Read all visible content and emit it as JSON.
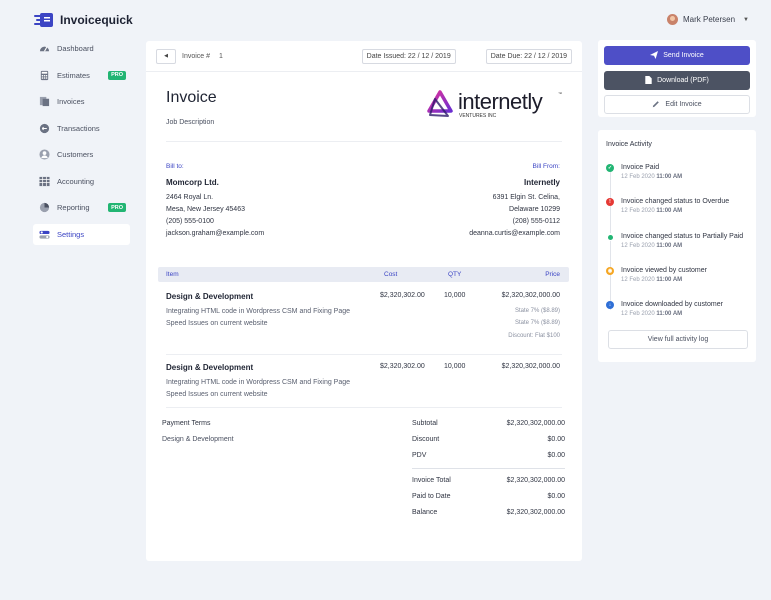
{
  "app": {
    "name": "Invoicequick"
  },
  "user": {
    "name": "Mark Petersen"
  },
  "sidebar": {
    "items": [
      {
        "label": "Dashboard",
        "icon": "dashboard-icon",
        "pro": ""
      },
      {
        "label": "Estimates",
        "icon": "calculator-icon",
        "pro": "PRO"
      },
      {
        "label": "Invoices",
        "icon": "invoice-icon",
        "pro": ""
      },
      {
        "label": "Transactions",
        "icon": "transactions-icon",
        "pro": ""
      },
      {
        "label": "Customers",
        "icon": "customer-icon",
        "pro": ""
      },
      {
        "label": "Accounting",
        "icon": "accounting-icon",
        "pro": ""
      },
      {
        "label": "Reporting",
        "icon": "reporting-icon",
        "pro": "PRO"
      },
      {
        "label": "Settings",
        "icon": "settings-icon",
        "pro": "",
        "active": true
      }
    ]
  },
  "invoice": {
    "number_label": "Invoice #",
    "number": "1",
    "date_issued": "Date Issued: 22 / 12 / 2019",
    "date_due": "Date Due: 22 / 12 / 2019",
    "title": "Invoice",
    "job_description": "Job Description",
    "brand": {
      "name": "internetly",
      "sub": "VENTURES INC",
      "tm": "™"
    },
    "bill_to": {
      "label": "Bill to:",
      "name": "Momcorp Ltd.",
      "lines": [
        "2464 Royal Ln.",
        "Mesa, New Jersey 45463",
        "(205) 555-0100",
        "jackson.graham@example.com"
      ]
    },
    "bill_from": {
      "label": "Bill From:",
      "name": "Internetly",
      "lines": [
        "6391 Elgin St. Celina,",
        "Delaware 10299",
        "(208) 555-0112",
        "deanna.curtis@example.com"
      ]
    },
    "table": {
      "headers": {
        "item": "Item",
        "cost": "Cost",
        "qty": "QTY",
        "price": "Price"
      },
      "rows": [
        {
          "title": "Design & Development",
          "cost": "$2,320,302.00",
          "qty": "10,000",
          "price": "$2,320,302,000.00",
          "desc": [
            "Integrating HTML code in Wordpress CSM and Fixing Page",
            "Speed Issues on current website"
          ],
          "notes": [
            "State 7% ($8.89)",
            "State 7% ($8.89)",
            "Discount: Flat $100"
          ]
        },
        {
          "title": "Design & Development",
          "cost": "$2,320,302.00",
          "qty": "10,000",
          "price": "$2,320,302,000.00",
          "desc": [
            "Integrating HTML code in Wordpress CSM and Fixing Page",
            "Speed Issues on current website"
          ],
          "notes": []
        }
      ]
    },
    "payment_terms": {
      "label": "Payment Terms",
      "value": "Design & Development"
    },
    "summary": [
      {
        "label": "Subtotal",
        "value": "$2,320,302,000.00"
      },
      {
        "label": "Discount",
        "value": "$0.00"
      },
      {
        "label": "PDV",
        "value": "$0.00"
      },
      {
        "label": "Invoice Total",
        "value": "$2,320,302,000.00"
      },
      {
        "label": "Paid to Date",
        "value": "$0.00"
      },
      {
        "label": "Balance",
        "value": "$2,320,302,000.00"
      }
    ]
  },
  "actions": {
    "send": "Send Invoice",
    "download": "Download (PDF)",
    "edit": "Edit Invoice"
  },
  "activity": {
    "title": "Invoice Activity",
    "items": [
      {
        "text": "Invoice Paid",
        "date": "12 Feb 2020",
        "time": "11:00 AM",
        "color": "#22b573",
        "icon": "check-icon"
      },
      {
        "text": "Invoice changed status to Overdue",
        "date": "12 Feb 2020",
        "time": "11:00 AM",
        "color": "#e53935",
        "icon": "alert-icon"
      },
      {
        "text": "Invoice changed status to Partially Paid",
        "date": "12 Feb 2020",
        "time": "11:00 AM",
        "color": "#22b573",
        "icon": "dot-icon"
      },
      {
        "text": "Invoice viewed by customer",
        "date": "12 Feb 2020",
        "time": "11:00 AM",
        "color": "#f5a623",
        "icon": "eye-icon"
      },
      {
        "text": "Invoice downloaded by customer",
        "date": "12 Feb 2020",
        "time": "11:00 AM",
        "color": "#2f6fd6",
        "icon": "download-icon"
      }
    ],
    "view_full": "View full activity log"
  },
  "colors": {
    "accent": "#3b44c4",
    "send_button": "#4e4fc7",
    "download_button": "#4c5363",
    "pro_badge": "#22b573"
  }
}
